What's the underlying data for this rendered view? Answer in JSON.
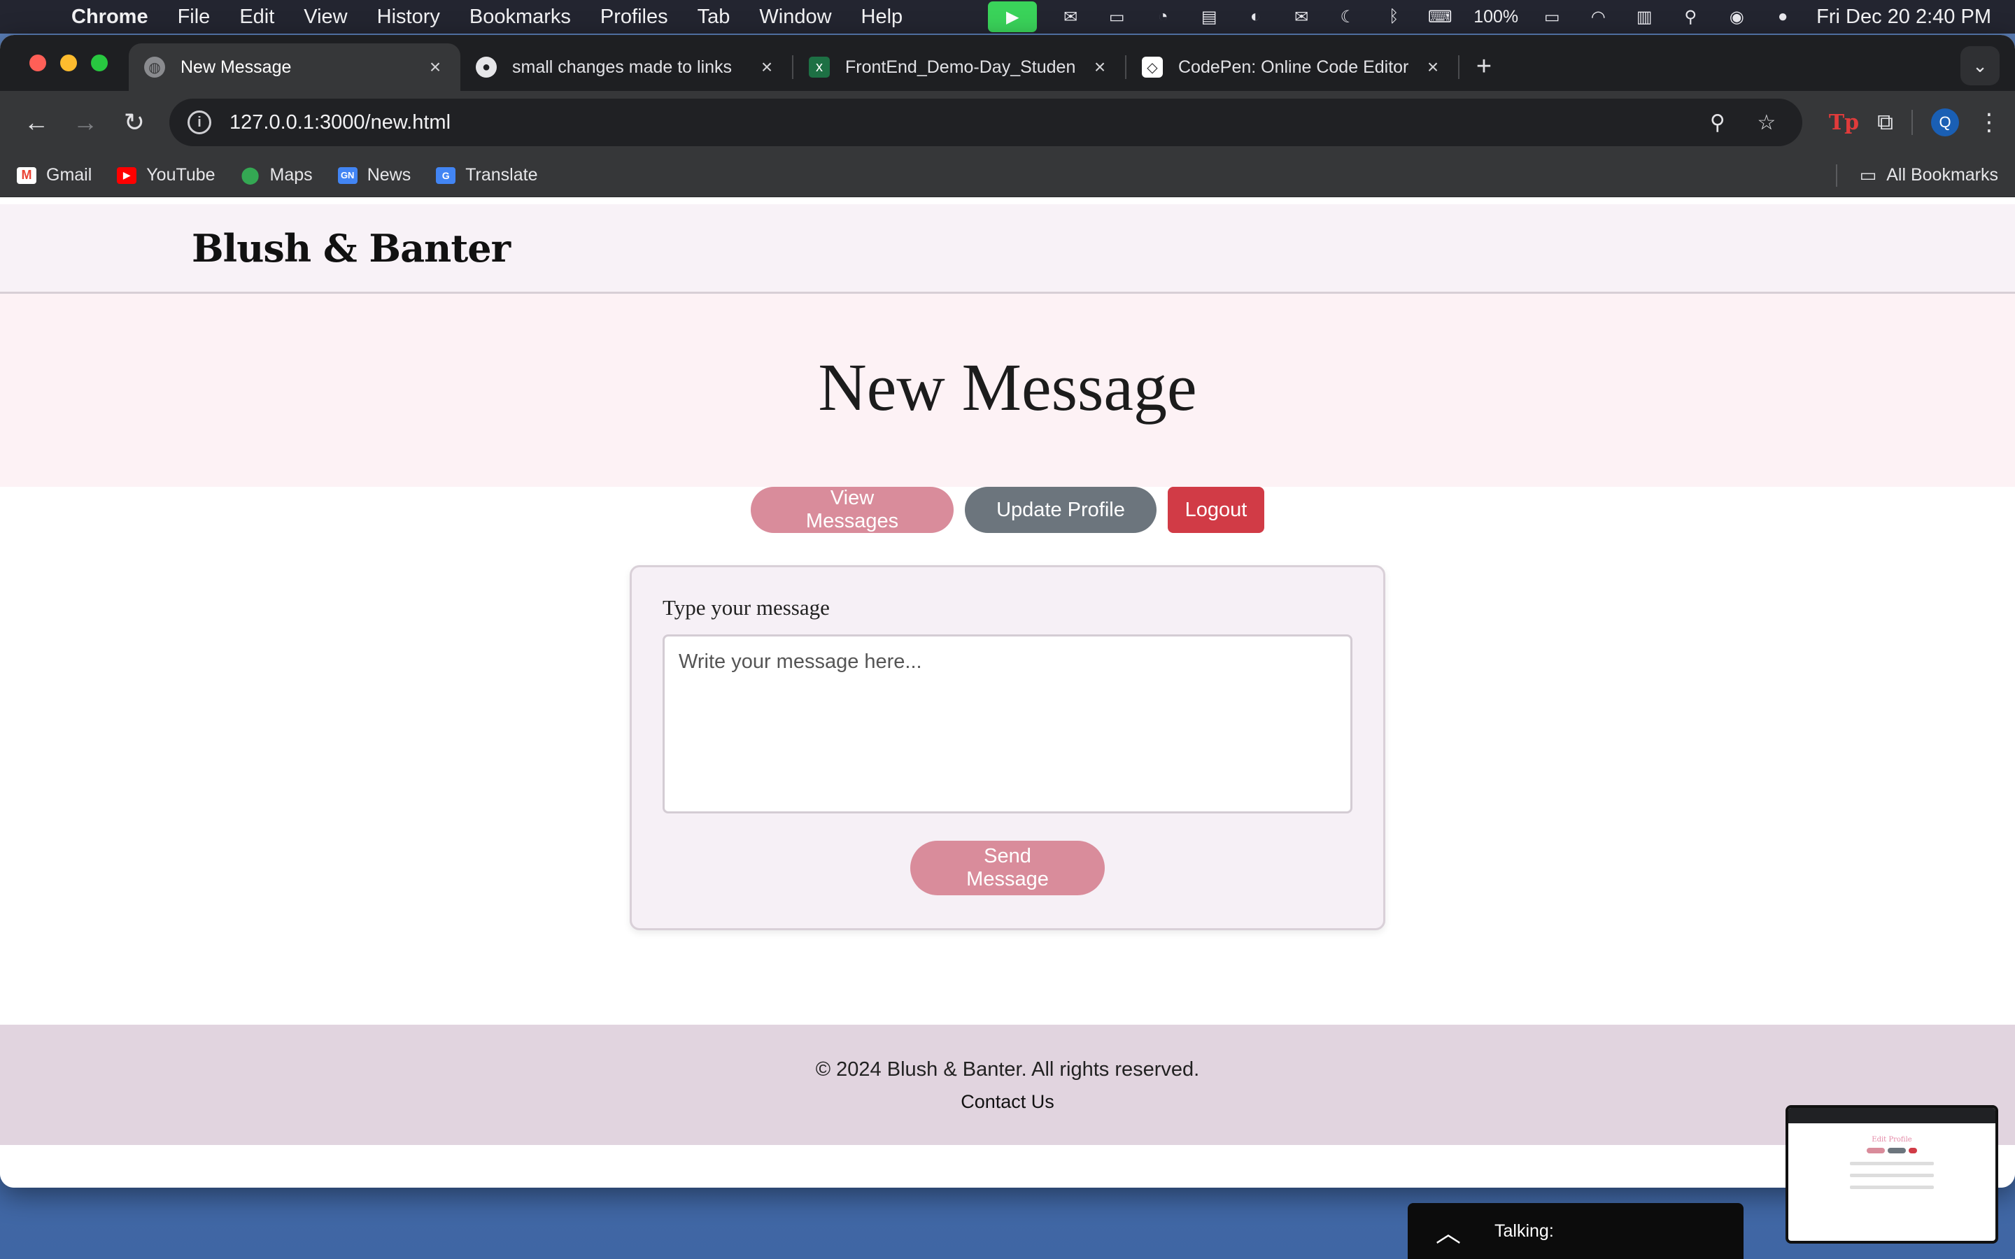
{
  "menubar": {
    "app_name": "Chrome",
    "items": [
      "File",
      "Edit",
      "View",
      "History",
      "Bookmarks",
      "Profiles",
      "Tab",
      "Window",
      "Help"
    ],
    "battery": "100%",
    "clock": "Fri Dec 20  2:40 PM"
  },
  "tabs": [
    {
      "title": "New Message",
      "icon": "globe-icon",
      "active": true
    },
    {
      "title": "small changes made to links",
      "icon": "github-icon",
      "active": false
    },
    {
      "title": "FrontEnd_Demo-Day_Studen",
      "icon": "excel-icon",
      "active": false
    },
    {
      "title": "CodePen: Online Code Editor",
      "icon": "codepen-icon",
      "active": false
    }
  ],
  "toolbar": {
    "url": "127.0.0.1:3000/new.html",
    "profile_initial": "Q",
    "extension_label": "Tp"
  },
  "bookmarks": {
    "items": [
      "Gmail",
      "YouTube",
      "Maps",
      "News",
      "Translate"
    ],
    "all_bookmarks": "All Bookmarks"
  },
  "site": {
    "brand": "Blush & Banter",
    "page_title": "New Message",
    "buttons": {
      "view_messages": "View Messages",
      "update_profile": "Update Profile",
      "logout": "Logout"
    },
    "form": {
      "label": "Type your message",
      "placeholder": "Write your message here...",
      "value": "",
      "submit": "Send Message"
    },
    "footer": {
      "copyright": "© 2024 Blush & Banter. All rights reserved.",
      "contact": "Contact Us"
    }
  },
  "overlay": {
    "talking_label": "Talking:",
    "pip_title": "Edit Profile"
  },
  "colors": {
    "accent_pink": "#d98c9b",
    "secondary_gray": "#6c757d",
    "danger_red": "#d13b46",
    "header_bg": "#f8f2f7",
    "hero_bg": "#fdf2f5",
    "footer_bg": "#e1d4df"
  }
}
